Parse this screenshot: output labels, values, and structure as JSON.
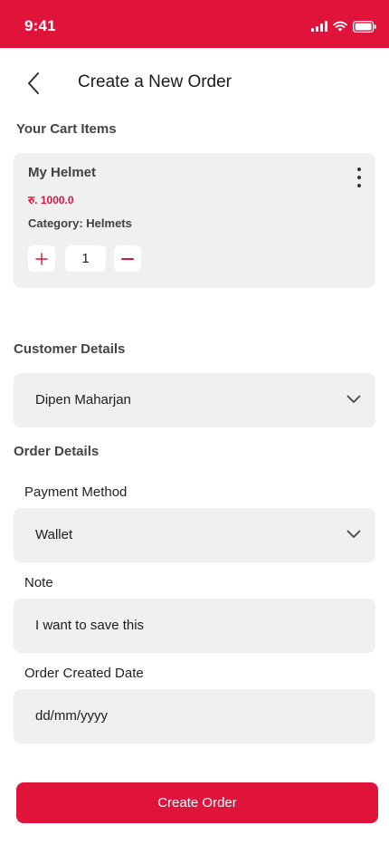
{
  "status_bar": {
    "time": "9:41"
  },
  "header": {
    "title": "Create a New Order"
  },
  "cart": {
    "heading": "Your Cart Items",
    "items": [
      {
        "name": "My Helmet",
        "price": "रु. 1000.0",
        "category": "Category: Helmets",
        "quantity": "1"
      }
    ]
  },
  "customer": {
    "heading": "Customer Details",
    "selected": "Dipen Maharjan"
  },
  "order": {
    "heading": "Order Details",
    "payment_label": "Payment Method",
    "payment_value": "Wallet",
    "note_label": "Note",
    "note_value": "I want to save this",
    "date_label": "Order Created Date",
    "date_placeholder": "dd/mm/yyyy"
  },
  "actions": {
    "submit_label": "Create Order"
  },
  "colors": {
    "accent": "#e0133a",
    "field_bg": "#f0f0f0"
  },
  "icons": [
    "signal-icon",
    "wifi-icon",
    "battery-icon",
    "back-arrow-icon",
    "more-vertical-icon",
    "plus-icon",
    "minus-icon",
    "chevron-down-icon"
  ]
}
